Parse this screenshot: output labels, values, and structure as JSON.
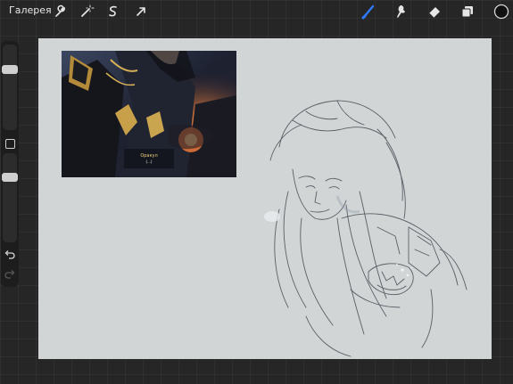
{
  "app": {
    "gallery_label": "Галерея"
  },
  "toolbar": {
    "left_tools": [
      "wrench-icon",
      "magic-wand-icon",
      "selection-icon",
      "transform-arrow-icon"
    ],
    "right_tools": [
      "brush-icon",
      "smudge-icon",
      "eraser-icon",
      "layers-icon",
      "color-swatch-icon"
    ],
    "active_tool": "brush",
    "accent_color": "#2f7bff",
    "icon_color": "#e6e6e6",
    "current_color": "#111111"
  },
  "sidebar": {
    "brush_size_level": 0.27,
    "opacity_level": 0.24
  },
  "canvas": {
    "background_color": "#d1d5d6",
    "reference_caption": "Оракул",
    "reference_subcaption": "(...)"
  }
}
